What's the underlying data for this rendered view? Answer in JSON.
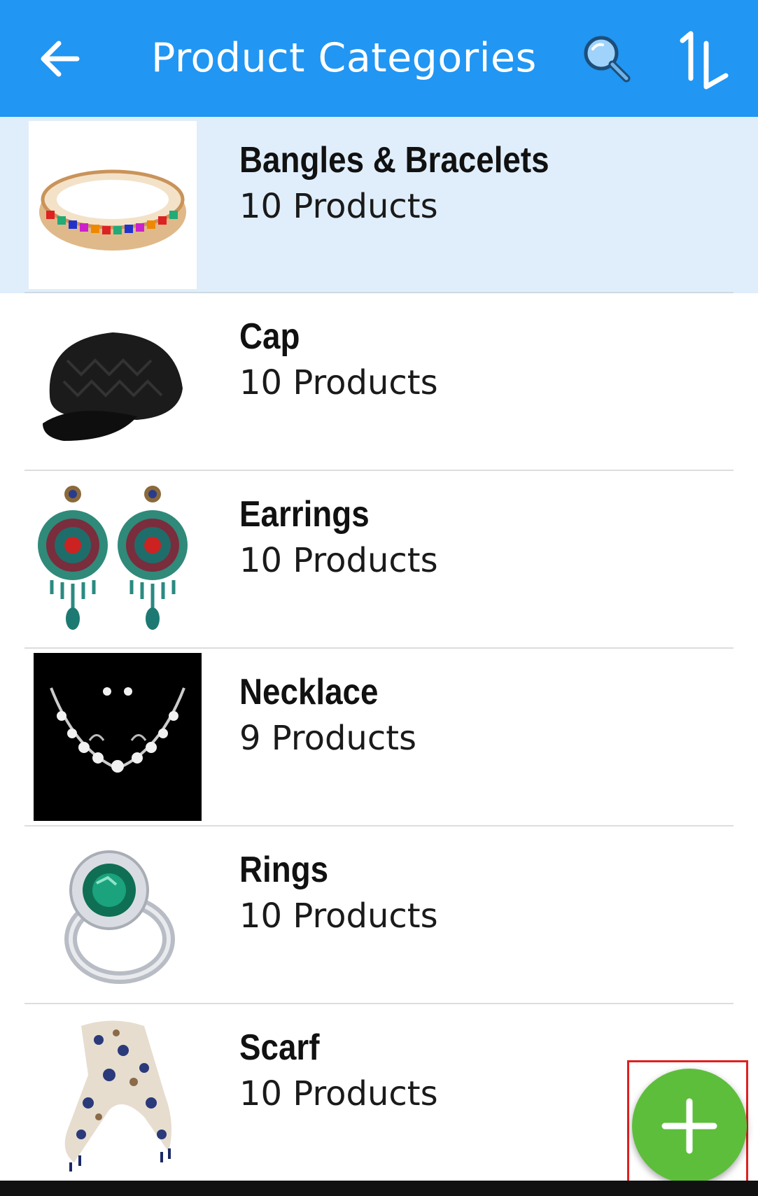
{
  "appbar": {
    "title": "Product Categories",
    "background": "#2196F3",
    "icons": [
      "back-arrow-icon",
      "search-icon",
      "sort-icon"
    ]
  },
  "categories": [
    {
      "name": "Bangles & Bracelets",
      "count": "10 Products",
      "image": "bracelet-image",
      "selected": true
    },
    {
      "name": "Cap",
      "count": "10 Products",
      "image": "cap-image"
    },
    {
      "name": "Earrings",
      "count": "10 Products",
      "image": "earrings-image"
    },
    {
      "name": "Necklace",
      "count": "9 Products",
      "image": "necklace-image"
    },
    {
      "name": "Rings",
      "count": "10 Products",
      "image": "ring-image"
    },
    {
      "name": "Scarf",
      "count": "10 Products",
      "image": "scarf-image"
    }
  ],
  "fab": {
    "icon": "plus-icon",
    "color": "#5DBE3C",
    "highlight_color": "#e02020"
  }
}
